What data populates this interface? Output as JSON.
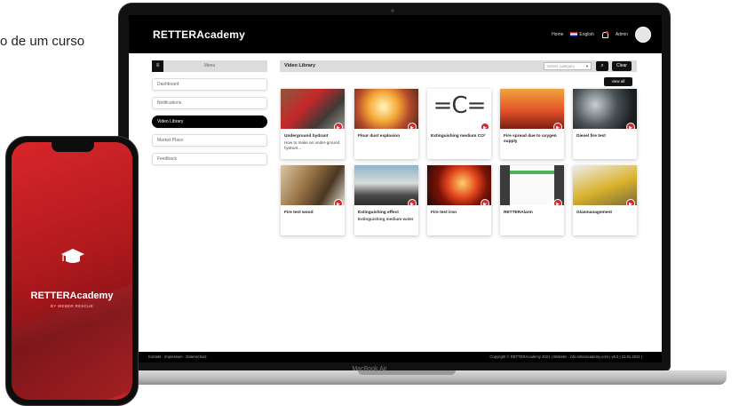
{
  "caption": "o de um curso",
  "app": {
    "logo": "RETTERAcademy",
    "nav": {
      "home": "Home",
      "language": "English",
      "user": "Admin"
    }
  },
  "sidebar": {
    "menu_label": "Menu",
    "items": [
      {
        "label": "Dashboard",
        "active": false
      },
      {
        "label": "Notifications",
        "active": false
      },
      {
        "label": "Video Library",
        "active": true
      },
      {
        "label": "Market Place",
        "active": false
      },
      {
        "label": "Feedback",
        "active": false
      }
    ]
  },
  "toolbar": {
    "title": "Video Library",
    "select_placeholder": "Select category",
    "clear_label": "Clear",
    "view_all_label": "view all"
  },
  "videos": [
    {
      "title": "Underground hydrant",
      "desc": "How to make an under-ground hydrant..."
    },
    {
      "title": "Flour dust explosion",
      "desc": ""
    },
    {
      "title": "Extinguishing medium CO²",
      "desc": ""
    },
    {
      "title": "Fire spread due to oxygen supply",
      "desc": ""
    },
    {
      "title": "Diesel fire test",
      "desc": ""
    },
    {
      "title": "Fire test wood",
      "desc": ""
    },
    {
      "title": "Extinguishing effect",
      "desc": "Extinguishing medium water"
    },
    {
      "title": "Fire test iron",
      "desc": ""
    },
    {
      "title": "RETTERAlarm",
      "desc": ""
    },
    {
      "title": "Glasmanagement",
      "desc": ""
    }
  ],
  "footer": {
    "links": "Kontakt · Impressum · Datenschutz",
    "copyright": "Copyright © RETTERAcademy 2021 | Website · info.retteracademy.com | v6.0 | 10.01.2021 |"
  },
  "laptop_brand": "MacBook Air",
  "phone": {
    "app_name": "RETTERAcademy",
    "subtitle": "BY WEBER RESCUE"
  },
  "colors": {
    "accent": "#d9262a",
    "header": "#000000",
    "phone_bg": "#c21f23"
  },
  "icons": {
    "play": "play-icon",
    "search": "search-icon",
    "notification": "bell-icon",
    "app": "graduation-cap-icon"
  }
}
